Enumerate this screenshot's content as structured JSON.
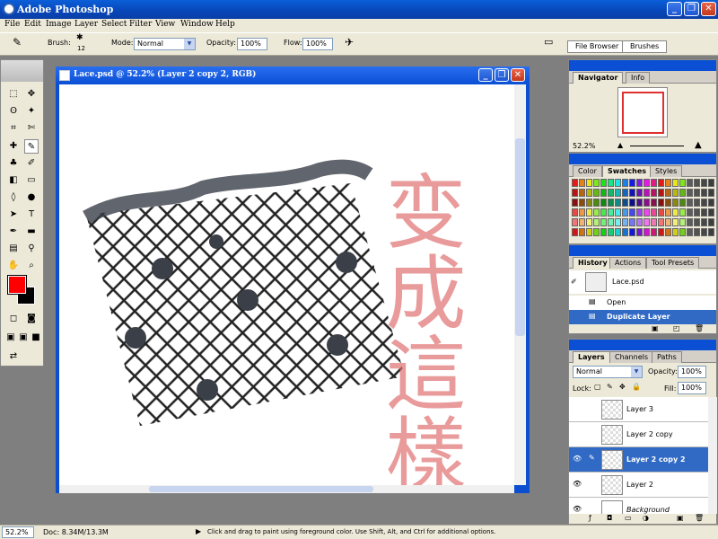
{
  "app": {
    "title": "Adobe Photoshop"
  },
  "menu": [
    "File",
    "Edit",
    "Image",
    "Layer",
    "Select",
    "Filter",
    "View",
    "Window",
    "Help"
  ],
  "options": {
    "brush_label": "Brush:",
    "brush_size": "12",
    "mode_label": "Mode:",
    "mode_value": "Normal",
    "opacity_label": "Opacity:",
    "opacity_value": "100%",
    "flow_label": "Flow:",
    "flow_value": "100%",
    "file_browser": "File Browser",
    "brushes": "Brushes"
  },
  "document": {
    "title": "Lace.psd @ 52.2% (Layer 2 copy 2, RGB)",
    "handwriting": "变成這樣"
  },
  "navigator": {
    "tabs": [
      "Navigator",
      "Info"
    ],
    "zoom": "52.2%"
  },
  "swatches": {
    "tabs": [
      "Color",
      "Swatches",
      "Styles"
    ]
  },
  "history": {
    "tabs": [
      "History",
      "Actions",
      "Tool Presets"
    ],
    "snapshot": "Lace.psd",
    "items": [
      "Open",
      "Duplicate Layer"
    ]
  },
  "layers": {
    "tabs": [
      "Layers",
      "Channels",
      "Paths"
    ],
    "blend_mode": "Normal",
    "opacity_label": "Opacity:",
    "opacity_value": "100%",
    "lock_label": "Lock:",
    "fill_label": "Fill:",
    "fill_value": "100%",
    "rows": [
      "Layer 3",
      "Layer 2 copy",
      "Layer 2 copy 2",
      "Layer 2",
      "Background"
    ]
  },
  "status": {
    "zoom": "52.2%",
    "doc": "Doc: 8.34M/13.3M",
    "hint": "Click and drag to paint using foreground color.  Use Shift, Alt, and Ctrl for additional options."
  },
  "colors": {
    "foreground": "#ff0000",
    "background": "#000000",
    "xp_blue": "#0a4fd4"
  }
}
